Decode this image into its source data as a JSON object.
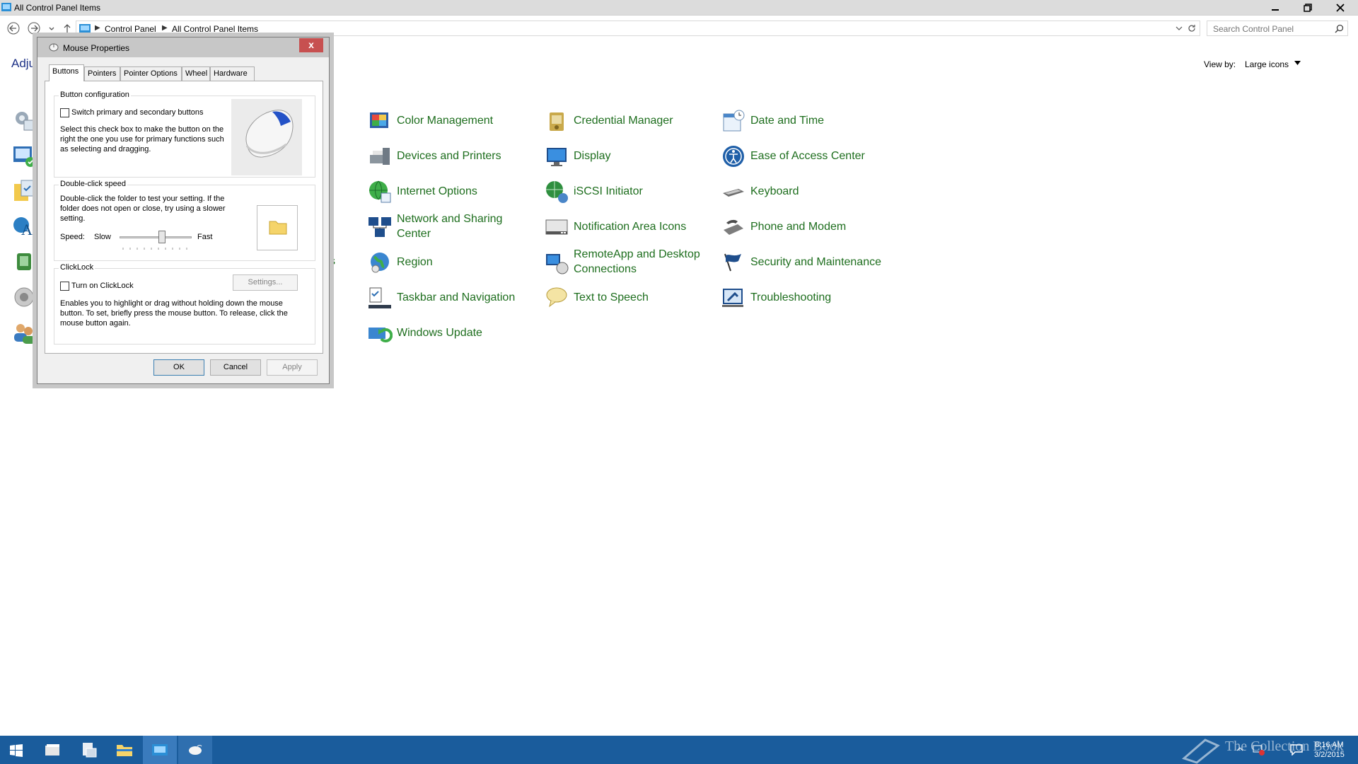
{
  "window": {
    "title": "All Control Panel Items",
    "minimize": "",
    "maximize": "",
    "close": ""
  },
  "address": {
    "crumbs": [
      "Control Panel",
      "All Control Panel Items"
    ],
    "search_placeholder": "Search Control Panel"
  },
  "content": {
    "heading_partial": "Adju",
    "view_by_label": "View by:",
    "view_by_value": "Large icons",
    "hidden_item_fragment": "s"
  },
  "items": [
    {
      "label": "Color Management",
      "icon": "color-management-icon"
    },
    {
      "label": "Credential Manager",
      "icon": "credential-manager-icon"
    },
    {
      "label": "Date and Time",
      "icon": "date-time-icon"
    },
    {
      "label": "Devices and Printers",
      "icon": "devices-printers-icon"
    },
    {
      "label": "Display",
      "icon": "display-icon"
    },
    {
      "label": "Ease of Access Center",
      "icon": "ease-of-access-icon"
    },
    {
      "label": "Internet Options",
      "icon": "internet-options-icon"
    },
    {
      "label": "iSCSI Initiator",
      "icon": "iscsi-icon"
    },
    {
      "label": "Keyboard",
      "icon": "keyboard-icon"
    },
    {
      "label": "Network and Sharing Center",
      "icon": "network-sharing-icon"
    },
    {
      "label": "Notification Area Icons",
      "icon": "notification-area-icon"
    },
    {
      "label": "Phone and Modem",
      "icon": "phone-modem-icon"
    },
    {
      "label": "Region",
      "icon": "region-icon"
    },
    {
      "label": "RemoteApp and Desktop Connections",
      "icon": "remoteapp-icon"
    },
    {
      "label": "Security and Maintenance",
      "icon": "security-flag-icon"
    },
    {
      "label": "Taskbar and Navigation",
      "icon": "taskbar-icon"
    },
    {
      "label": "Text to Speech",
      "icon": "text-to-speech-icon"
    },
    {
      "label": "Troubleshooting",
      "icon": "troubleshooting-icon"
    },
    {
      "label": "Windows Update",
      "icon": "windows-update-icon"
    }
  ],
  "dialog": {
    "title": "Mouse Properties",
    "close": "x",
    "tabs": [
      "Buttons",
      "Pointers",
      "Pointer Options",
      "Wheel",
      "Hardware"
    ],
    "active_tab": "Buttons",
    "button_config": {
      "title": "Button configuration",
      "checkbox_label": "Switch primary and secondary buttons",
      "checked": false,
      "description": "Select this check box to make the button on the right the one you use for primary functions such as selecting and dragging."
    },
    "double_click": {
      "title": "Double-click speed",
      "description": "Double-click the folder to test your setting. If the folder does not open or close, try using a slower setting.",
      "speed_label": "Speed:",
      "slow_label": "Slow",
      "fast_label": "Fast",
      "speed_value": 0.6
    },
    "clicklock": {
      "title": "ClickLock",
      "checkbox_label": "Turn on ClickLock",
      "checked": false,
      "settings_button": "Settings...",
      "description": "Enables you to highlight or drag without holding down the mouse button. To set, briefly press the mouse button. To release, click the mouse button again."
    },
    "ok": "OK",
    "cancel": "Cancel",
    "apply": "Apply"
  },
  "taskbar": {
    "time": "8:16 AM",
    "date": "3/2/2015",
    "watermark": "The Collection Book"
  },
  "colors": {
    "link_green": "#1e6e1e",
    "taskbar_blue": "#1a5c9c",
    "close_red": "#c75050"
  }
}
